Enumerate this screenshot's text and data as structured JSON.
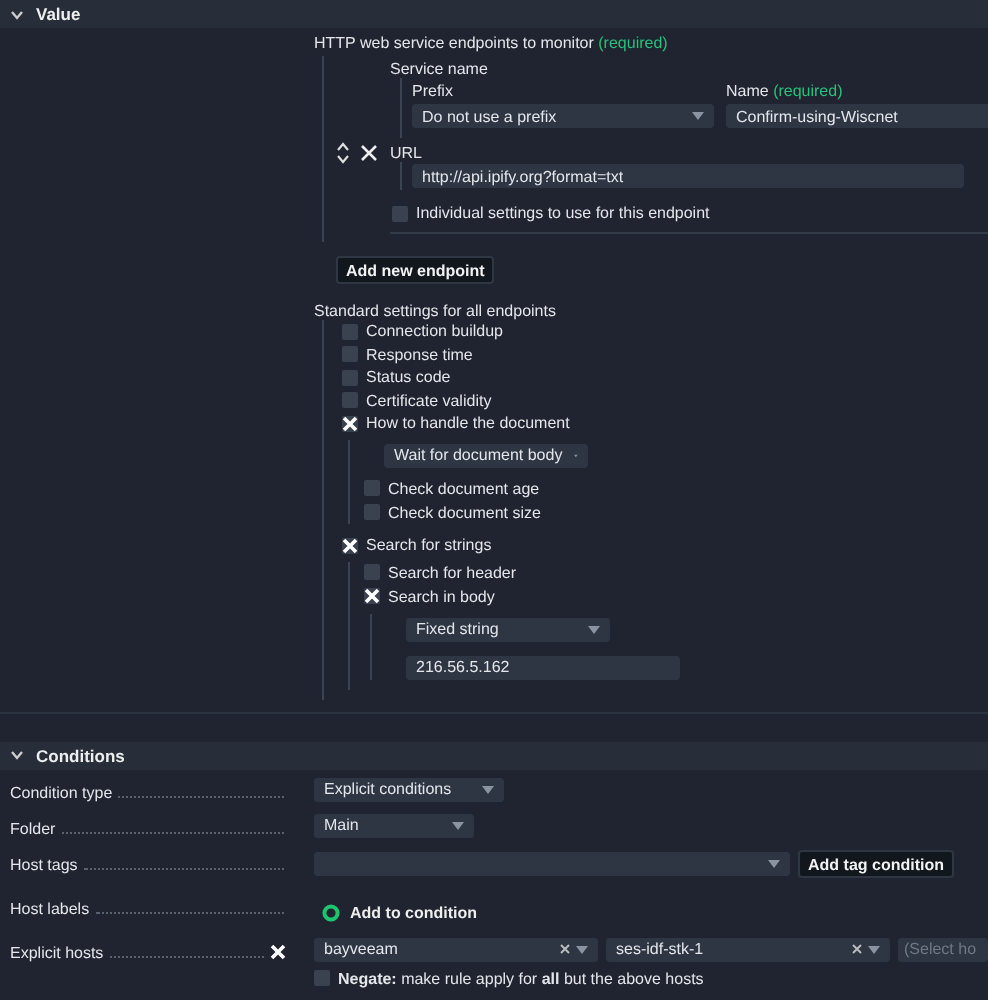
{
  "value": {
    "title": "Value",
    "expanded": true,
    "endpoints_label": "HTTP web service endpoints to monitor",
    "endpoints_required": "(required)",
    "endpoint": {
      "service_name_label": "Service name",
      "prefix_label": "Prefix",
      "prefix_value": "Do not use a prefix",
      "name_label": "Name",
      "name_required": "(required)",
      "name_value": "Confirm-using-Wiscnet",
      "url_label": "URL",
      "url_value": "http://api.ipify.org?format=txt",
      "individual": {
        "label": "Individual settings to use for this endpoint",
        "checked": false
      }
    },
    "add_button": "Add new endpoint",
    "standard_label": "Standard settings for all endpoints",
    "settings": [
      {
        "kind": "checkbox",
        "label": "Connection buildup",
        "checked": false
      },
      {
        "kind": "checkbox",
        "label": "Response time",
        "checked": false
      },
      {
        "kind": "checkbox",
        "label": "Status code",
        "checked": false
      },
      {
        "kind": "checkbox",
        "label": "Certificate validity",
        "checked": false
      },
      {
        "kind": "checkbox",
        "label": "How to handle the document",
        "checked": true,
        "children": [
          {
            "kind": "dropdown",
            "value": "Wait for document body"
          },
          {
            "kind": "checkbox",
            "label": "Check document age",
            "checked": false
          },
          {
            "kind": "checkbox",
            "label": "Check document size",
            "checked": false
          }
        ]
      },
      {
        "kind": "checkbox",
        "label": "Search for strings",
        "checked": true,
        "children": [
          {
            "kind": "checkbox",
            "label": "Search for header",
            "checked": false
          },
          {
            "kind": "checkbox",
            "label": "Search in body",
            "checked": true,
            "children": [
              {
                "kind": "dropdown",
                "value": "Fixed string"
              },
              {
                "kind": "field",
                "value": "216.56.5.162"
              }
            ]
          }
        ]
      }
    ]
  },
  "conditions": {
    "title": "Conditions",
    "expanded": true,
    "rows": [
      {
        "kind": "dropdown",
        "label": "Condition type",
        "value": "Explicit conditions"
      },
      {
        "kind": "dropdown",
        "label": "Folder",
        "value": "Main"
      },
      {
        "kind": "tags",
        "label": "Host tags",
        "button": "Add tag condition"
      },
      {
        "kind": "add",
        "label": "Host labels",
        "link": "Add to condition"
      },
      {
        "kind": "hosts",
        "label": "Explicit hosts",
        "checked": true,
        "hosts": [
          "bayveeam",
          "ses-idf-stk-1"
        ],
        "placeholder": "(Select ho",
        "negate": {
          "checked": false,
          "text": "**Negate:** make rule apply for **all** but the above hosts"
        }
      }
    ]
  }
}
